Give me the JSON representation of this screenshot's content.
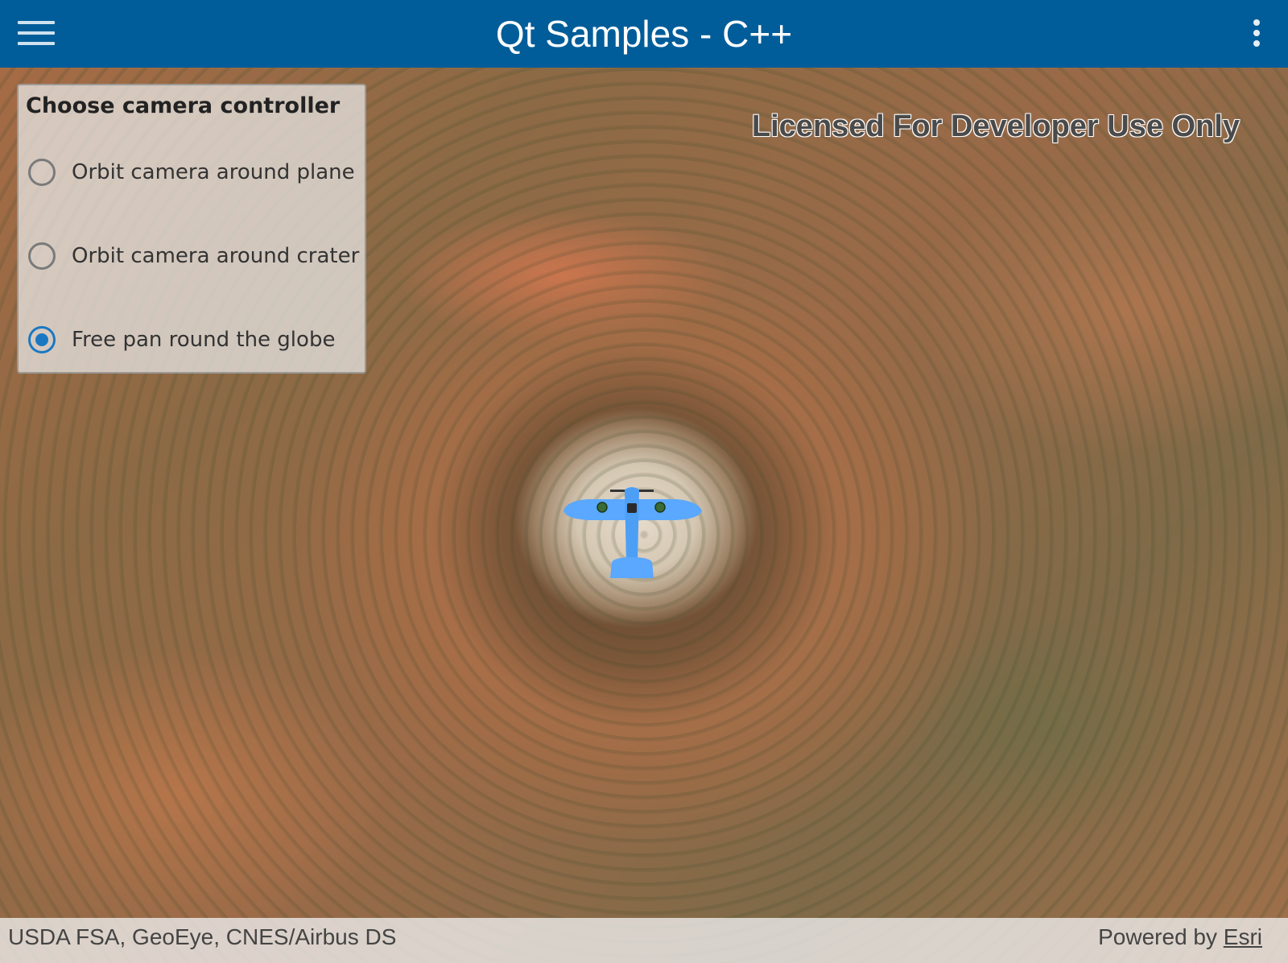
{
  "header": {
    "title": "Qt Samples - C++",
    "menu_icon": "hamburger-menu-icon",
    "overflow_icon": "more-vertical-icon",
    "background_color": "#005d99"
  },
  "map": {
    "watermark": "Licensed For Developer Use Only",
    "plane_icon": "airplane-graphic"
  },
  "camera_panel": {
    "title": "Choose camera controller",
    "options": [
      {
        "label": "Orbit camera around plane",
        "selected": false
      },
      {
        "label": "Orbit camera around crater",
        "selected": false
      },
      {
        "label": "Free pan round the globe",
        "selected": true
      }
    ],
    "accent_color": "#1a78c2"
  },
  "attribution": {
    "sources": "USDA FSA, GeoEye, CNES/Airbus DS",
    "powered_by_prefix": "Powered by ",
    "powered_by_link": "Esri"
  }
}
